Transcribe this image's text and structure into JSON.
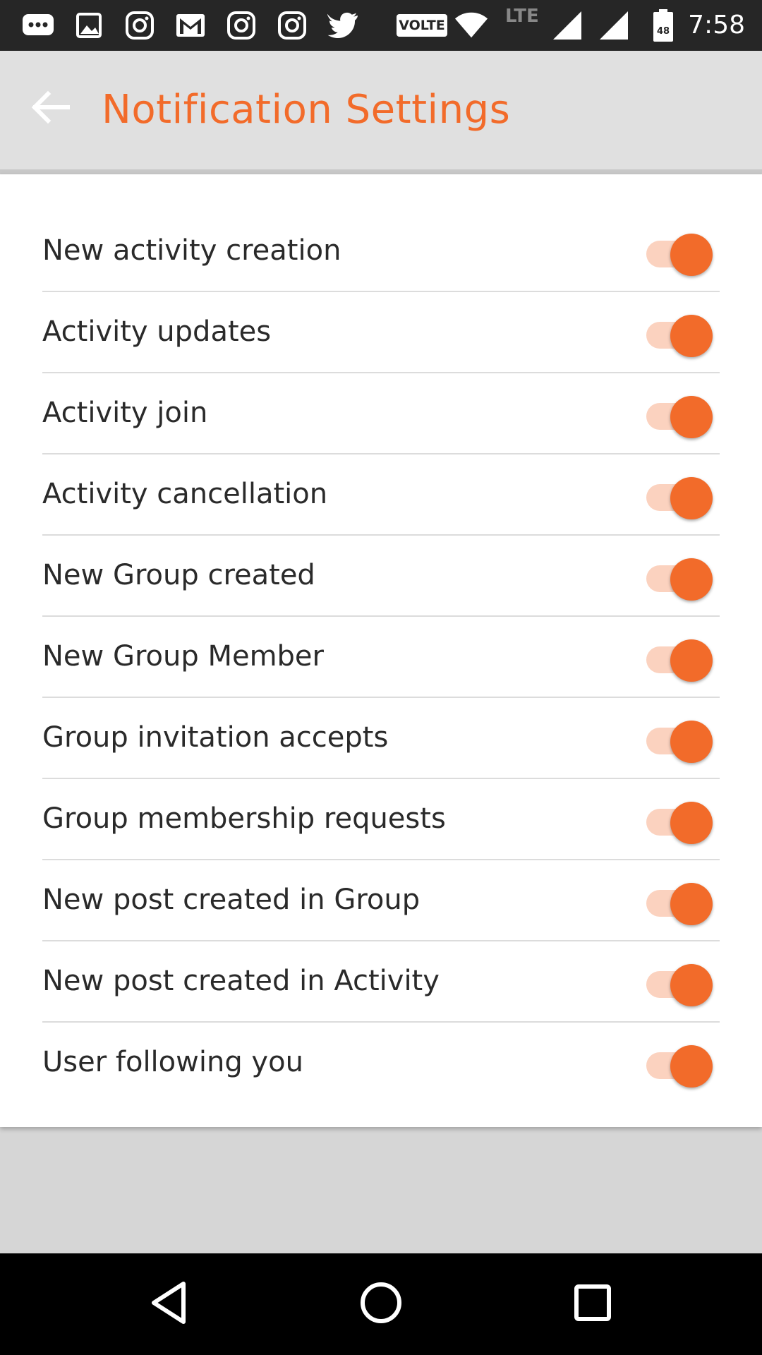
{
  "status_bar": {
    "time": "7:58",
    "volte_label": "VOLTE",
    "network_label": "LTE",
    "battery_level": "48",
    "notification_icons": [
      "message-icon",
      "image-icon",
      "instagram-icon",
      "gmail-icon",
      "instagram-icon",
      "instagram-icon",
      "twitter-icon"
    ]
  },
  "app_bar": {
    "title": "Notification Settings",
    "back_icon": "arrow-left-icon"
  },
  "settings": [
    {
      "label": "New activity creation",
      "enabled": true
    },
    {
      "label": "Activity updates",
      "enabled": true
    },
    {
      "label": "Activity join",
      "enabled": true
    },
    {
      "label": "Activity cancellation",
      "enabled": true
    },
    {
      "label": "New Group created",
      "enabled": true
    },
    {
      "label": "New Group Member",
      "enabled": true
    },
    {
      "label": "Group invitation accepts",
      "enabled": true
    },
    {
      "label": "Group membership requests",
      "enabled": true
    },
    {
      "label": "New post created in Group",
      "enabled": true
    },
    {
      "label": "New post created in Activity",
      "enabled": true
    },
    {
      "label": "User following you",
      "enabled": true
    }
  ],
  "colors": {
    "accent": "#f26b2a",
    "toggle_track_on": "#fbd2bf",
    "app_bar_bg": "#e0e0e0"
  },
  "nav_bar": {
    "icons": [
      "back-triangle-icon",
      "home-circle-icon",
      "recents-square-icon"
    ]
  }
}
